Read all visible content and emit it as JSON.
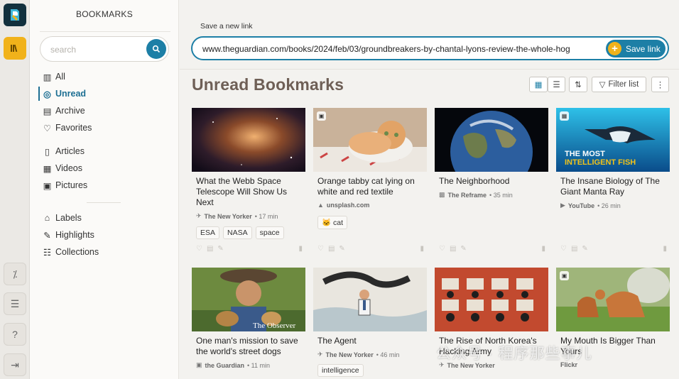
{
  "sidebar": {
    "title": "BOOKMARKS",
    "search_placeholder": "search",
    "items": [
      {
        "label": "All"
      },
      {
        "label": "Unread"
      },
      {
        "label": "Archive"
      },
      {
        "label": "Favorites"
      },
      {
        "label": "Articles"
      },
      {
        "label": "Videos"
      },
      {
        "label": "Pictures"
      },
      {
        "label": "Labels"
      },
      {
        "label": "Highlights"
      },
      {
        "label": "Collections"
      }
    ]
  },
  "topbar": {
    "save_label": "Save a new link",
    "url_value": "www.theguardian.com/books/2024/feb/03/groundbreakers-by-chantal-lyons-review-the-whole-hog",
    "save_button": "Save link"
  },
  "main": {
    "heading": "Unread Bookmarks",
    "filter_label": "Filter list",
    "cards": [
      {
        "title": "What the Webb Space Telescope Will Show Us Next",
        "source": "The New Yorker",
        "time": "• 17 min",
        "tags": [
          "ESA",
          "NASA",
          "space"
        ]
      },
      {
        "title": "Orange tabby cat lying on white and red textile",
        "source": "unsplash.com",
        "time": "",
        "tags": [
          "🐱 cat"
        ]
      },
      {
        "title": "The Neighborhood",
        "source": "The Reframe",
        "time": "• 35 min",
        "tags": []
      },
      {
        "title": "The Insane Biology of The Giant Manta Ray",
        "source": "YouTube",
        "time": "• 26 min",
        "tags": [],
        "thumb_text": "THE MOST INTELLIGENT FISH"
      },
      {
        "title": "One man's mission to save the world's street dogs",
        "source": "the Guardian",
        "time": "• 11 min",
        "tags": [],
        "thumb_text": "The Observer"
      },
      {
        "title": "The Agent",
        "source": "The New Yorker",
        "time": "• 46 min",
        "tags": [
          "intelligence"
        ]
      },
      {
        "title": "The Rise of North Korea's Hacking Army",
        "source": "The New Yorker",
        "time": "",
        "tags": []
      },
      {
        "title": "My Mouth Is Bigger Than Yours",
        "source": "Flickr",
        "time": "",
        "tags": []
      }
    ]
  },
  "watermark": "公众号 · 程序那些事儿",
  "colors": {
    "accent": "#1d7fa6",
    "highlight": "#f1b21a",
    "heading": "#6e5f56"
  }
}
